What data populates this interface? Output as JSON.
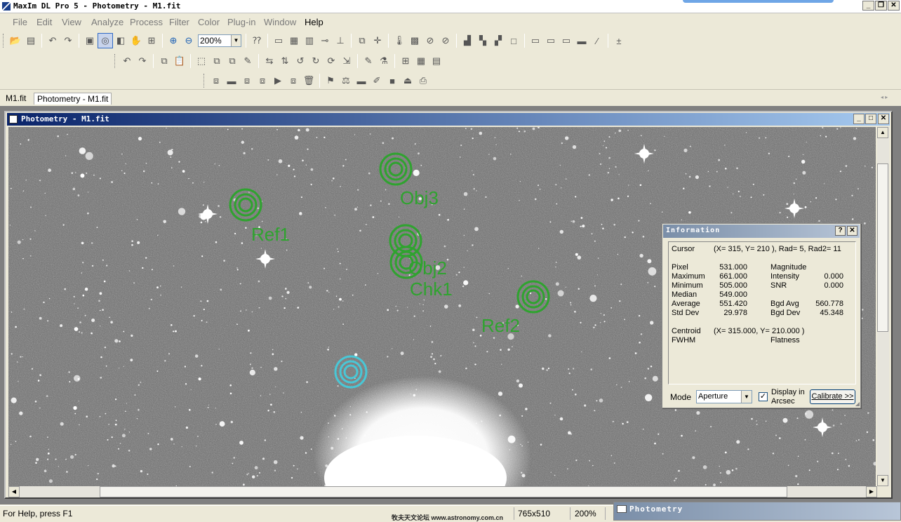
{
  "app": {
    "title": "MaxIm DL Pro 5 - Photometry - M1.fit",
    "minimize": "_",
    "restore": "❐",
    "close": "✕"
  },
  "menu": [
    "File",
    "Edit",
    "View",
    "Analyze",
    "Process",
    "Filter",
    "Color",
    "Plug-in",
    "Window",
    "Help"
  ],
  "toolbar": {
    "zoom_value": "200%"
  },
  "doc_tabs": [
    "M1.fit",
    "Photometry - M1.fit"
  ],
  "child_window": {
    "title": "Photometry - M1.fit"
  },
  "apertures": {
    "labels": [
      "Obj3",
      "Ref1",
      "Obj2",
      "Chk1",
      "Ref2"
    ],
    "label_color": "#2fa32f",
    "cursor_aperture_color": "#49c7d6"
  },
  "info": {
    "title": "Information",
    "help": "?",
    "close": "✕",
    "cursor_label": "Cursor",
    "cursor_value": "(X=  315, Y=  210 ), Rad=  5, Rad2= 11",
    "rows": [
      {
        "label": "Pixel",
        "value": "531.000",
        "label2": "Magnitude",
        "value2": ""
      },
      {
        "label": "Maximum",
        "value": "661.000",
        "label2": "Intensity",
        "value2": "0.000"
      },
      {
        "label": "Minimum",
        "value": "505.000",
        "label2": "SNR",
        "value2": "0.000"
      },
      {
        "label": "Median",
        "value": "549.000",
        "label2": "",
        "value2": ""
      },
      {
        "label": "Average",
        "value": "551.420",
        "label2": "Bgd Avg",
        "value2": "560.778"
      },
      {
        "label": "Std Dev",
        "value": "29.978",
        "label2": "Bgd Dev",
        "value2": "45.348"
      }
    ],
    "centroid_label": "Centroid",
    "centroid_value": "(X=  315.000, Y=  210.000 )",
    "fwhm_label": "FWHM",
    "flatness_label": "Flatness",
    "mode_label": "Mode",
    "mode_value": "Aperture",
    "display_arcsec_checked": true,
    "display_arcsec_label_1": "Display in",
    "display_arcsec_label_2": "Arcsec",
    "calibrate": "Calibrate >>"
  },
  "status": {
    "help": "For Help, press F1",
    "watermark": "牧夫天文论坛 www.astronomy.com.cn",
    "image_size": "765x510",
    "zoom": "200%"
  },
  "mini_window": {
    "title": "Photometry"
  }
}
